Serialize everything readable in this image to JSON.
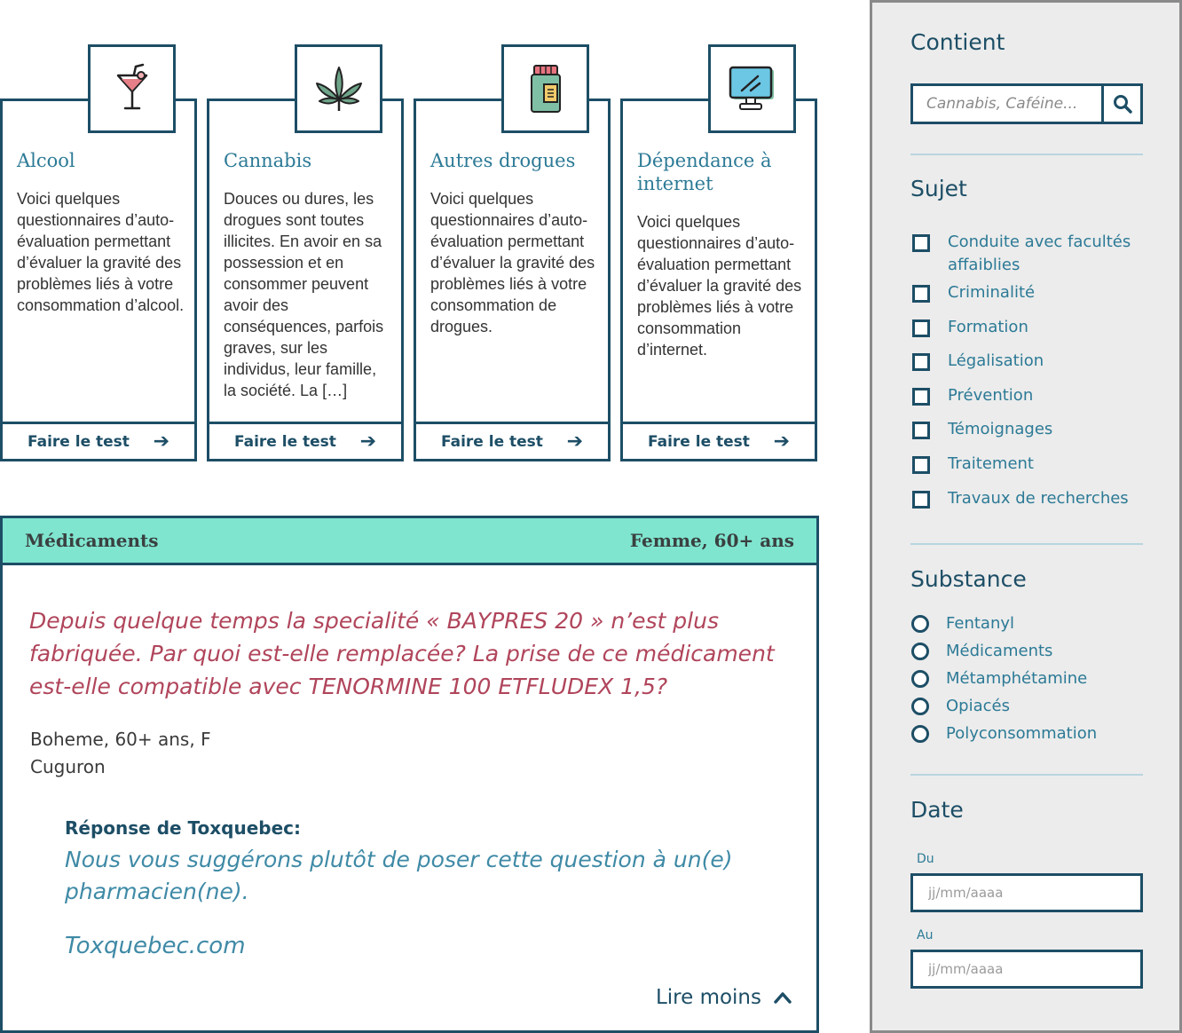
{
  "cards": [
    {
      "title": "Alcool",
      "text": "Voici quelques questionnaires d’auto-évaluation permettant d’évaluer la gravité des problèmes liés à votre consommation d’alcool.",
      "button": "Faire le test",
      "icon": "cocktail-icon"
    },
    {
      "title": "Cannabis",
      "text": "Douces ou dures, les drogues sont toutes illicites. En avoir en sa possession et en consommer peuvent avoir des conséquences, parfois graves, sur les individus, leur famille, la société. La […]",
      "button": "Faire le test",
      "icon": "cannabis-leaf-icon"
    },
    {
      "title": "Autres drogues",
      "text": "Voici quelques questionnaires d’auto-évaluation permettant d’évaluer la gravité des problèmes liés à votre consommation de drogues.",
      "button": "Faire le test",
      "icon": "pill-bottle-icon"
    },
    {
      "title": "Dépendance à internet",
      "text": "Voici quelques questionnaires d’auto-évaluation permettant d’évaluer la gravité des problèmes liés à votre consommation d’internet.",
      "button": "Faire le test",
      "icon": "computer-monitor-icon"
    }
  ],
  "question": {
    "category": "Médicaments",
    "profile": "Femme, 60+ ans",
    "text": "Depuis quelque temps la specialité « BAYPRES 20 » n’est plus fabriquée. Par quoi est-elle remplacée? La prise de ce médicament est-elle compatible avec TENORMINE 100 ETFLUDEX 1,5?",
    "author_line1": "Boheme, 60+ ans, F",
    "author_line2": "Cuguron",
    "response_label": "Réponse de Toxquebec:",
    "response_text": "Nous vous suggérons plutôt de poser cette question à un(e) pharmacien(ne).",
    "response_site": "Toxquebec.com",
    "read_less": "Lire moins"
  },
  "sidebar": {
    "contains_title": "Contient",
    "search_placeholder": "Cannabis, Caféine...",
    "subject_title": "Sujet",
    "subjects": [
      "Conduite avec facultés affaiblies",
      "Criminalité",
      "Formation",
      "Légalisation",
      "Prévention",
      "Témoignages",
      "Traitement",
      "Travaux de recherches"
    ],
    "substance_title": "Substance",
    "substances": [
      "Fentanyl",
      "Médicaments",
      "Métamphétamine",
      "Opiacés",
      "Polyconsommation"
    ],
    "date_title": "Date",
    "from_label": "Du",
    "to_label": "Au",
    "date_placeholder": "jj/mm/aaaa"
  },
  "colors": {
    "primary": "#1d4e66",
    "link": "#2c7a96",
    "header_bg": "#7fe5cf",
    "question_text": "#b0455b",
    "sidebar_bg": "#ececec"
  }
}
